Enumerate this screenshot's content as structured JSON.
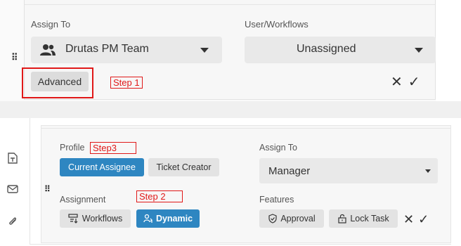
{
  "top": {
    "assign_to_label": "Assign To",
    "assign_to_value": "Drutas PM Team",
    "user_workflows_label": "User/Workflows",
    "user_workflows_value": "Unassigned",
    "advanced_label": "Advanced",
    "step1": "Step 1",
    "cancel_glyph": "✕",
    "confirm_glyph": "✓"
  },
  "bottom": {
    "profile_label": "Profile",
    "step3": "Step3",
    "profile_options": [
      "Current Assignee",
      "Ticket Creator"
    ],
    "assign_to_label": "Assign To",
    "assign_to_value": "Manager",
    "assignment_label": "Assignment",
    "step2": "Step 2",
    "assignment_options": [
      "Workflows",
      "Dynamic"
    ],
    "features_label": "Features",
    "features": [
      "Approval",
      "Lock Task"
    ],
    "cancel_glyph": "✕",
    "confirm_glyph": "✓"
  },
  "sidebar": {
    "icons": [
      "document-icon",
      "mail-icon",
      "paperclip-icon"
    ]
  },
  "colors": {
    "accent_blue": "#2e86c1",
    "step_red": "#e01818"
  }
}
